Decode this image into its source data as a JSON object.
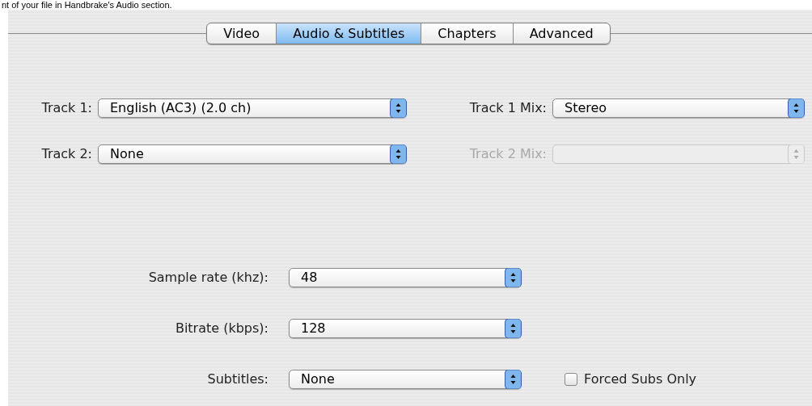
{
  "caption": "nt of your file in Handbrake's Audio section.",
  "tabs": [
    {
      "label": "Video",
      "selected": false
    },
    {
      "label": "Audio & Subtitles",
      "selected": true
    },
    {
      "label": "Chapters",
      "selected": false
    },
    {
      "label": "Advanced",
      "selected": false
    }
  ],
  "tracks": [
    {
      "label": "Track 1:",
      "value": "English (AC3) (2.0 ch)",
      "mix_label": "Track 1 Mix:",
      "mix_value": "Stereo",
      "mix_disabled": false
    },
    {
      "label": "Track 2:",
      "value": "None",
      "mix_label": "Track 2 Mix:",
      "mix_disabled": true
    }
  ],
  "settings": [
    {
      "label": "Sample rate (khz):",
      "value": "48"
    },
    {
      "label": "Bitrate (kbps):",
      "value": "128"
    },
    {
      "label": "Subtitles:",
      "value": "None",
      "checkbox": {
        "label": "Forced Subs Only",
        "checked": false
      }
    }
  ]
}
